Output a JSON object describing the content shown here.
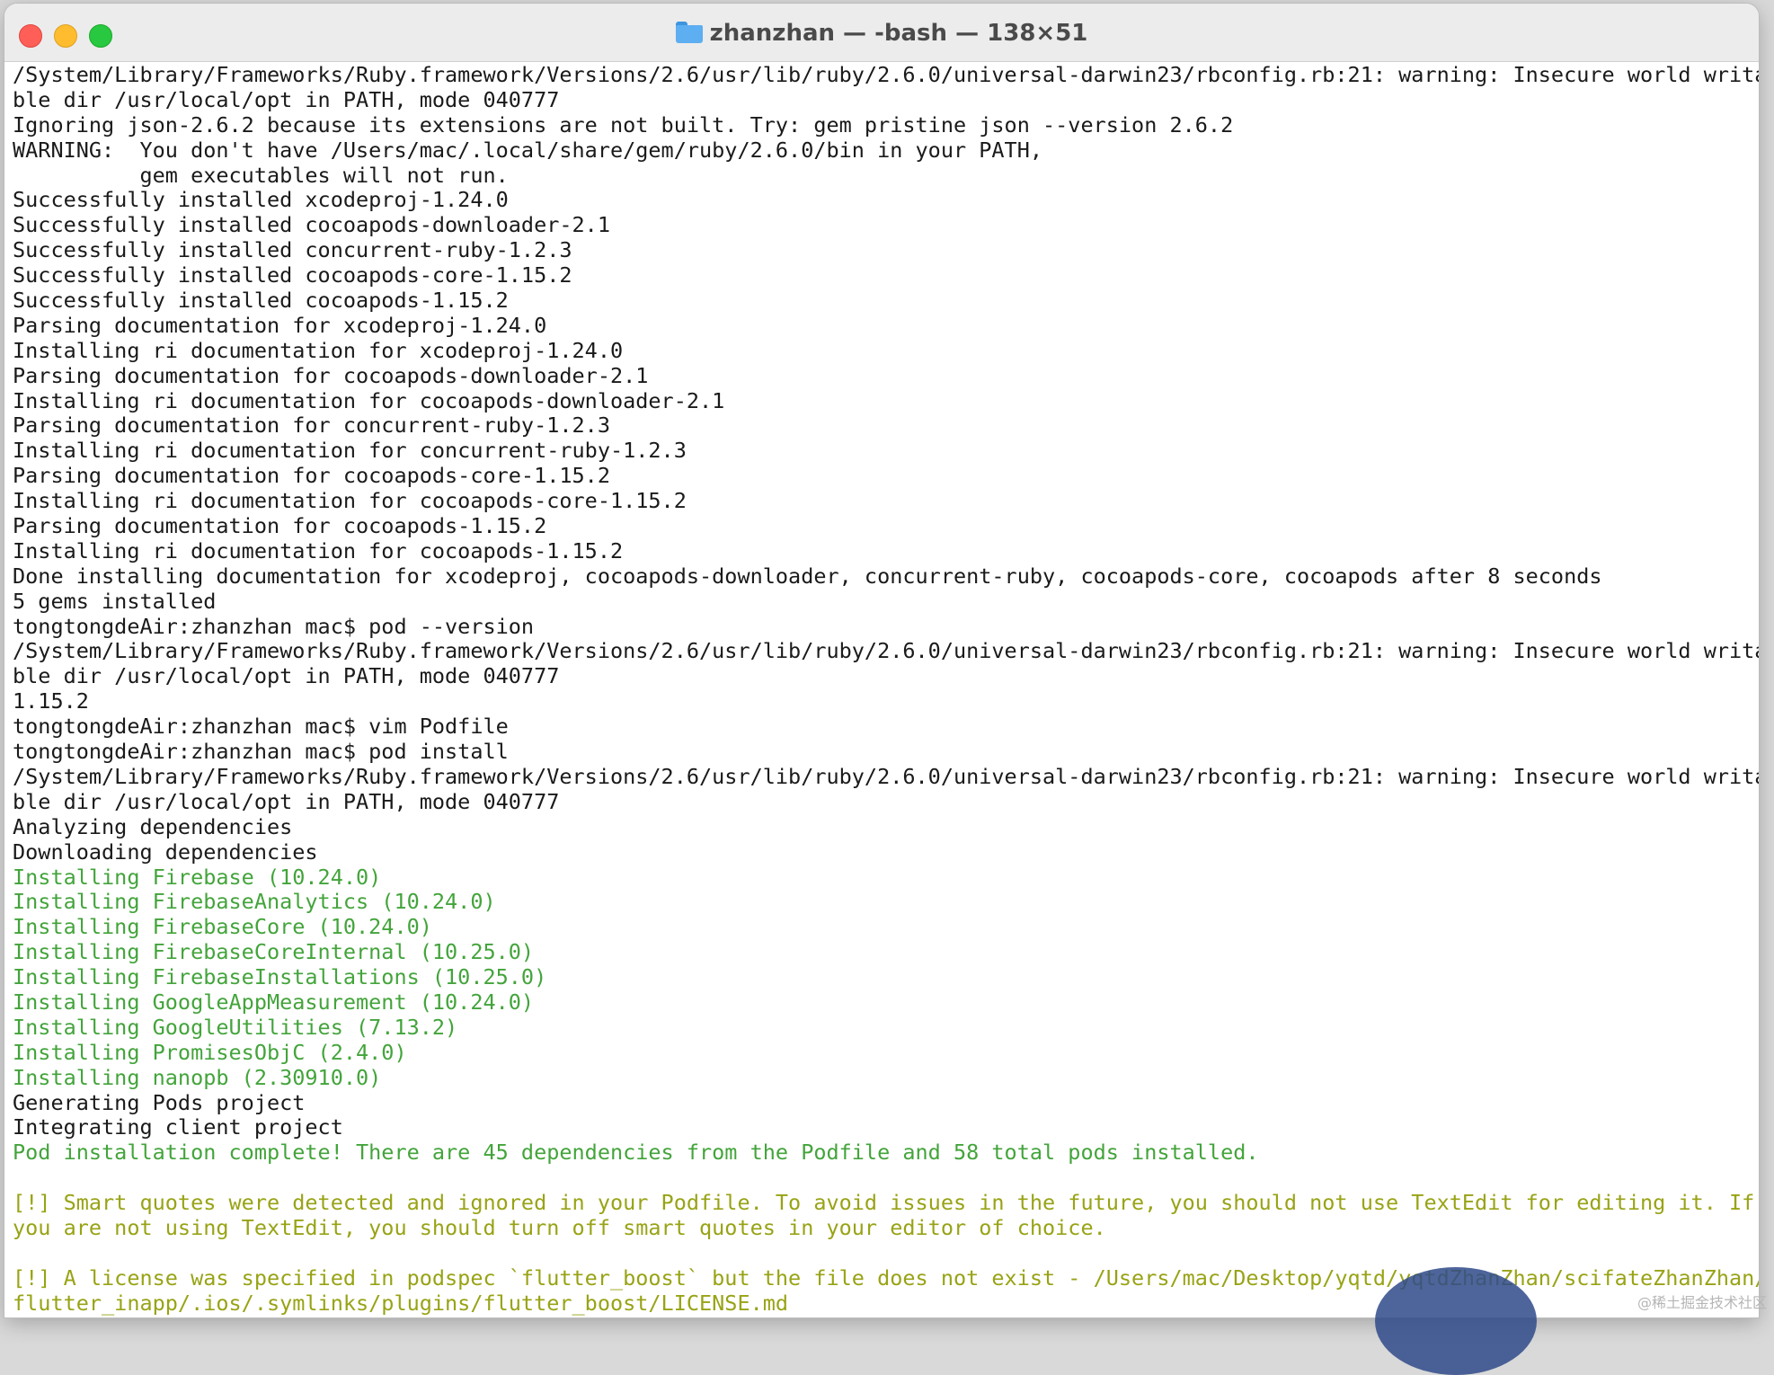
{
  "window": {
    "title": "zhanzhan — -bash — 138×51"
  },
  "colors": {
    "green": "#43a43b",
    "olive": "#98a315",
    "text": "#1a1a1a"
  },
  "terminal": {
    "lines": [
      {
        "text": "/System/Library/Frameworks/Ruby.framework/Versions/2.6/usr/lib/ruby/2.6.0/universal-darwin23/rbconfig.rb:21: warning: Insecure world writa",
        "color": "default"
      },
      {
        "text": "ble dir /usr/local/opt in PATH, mode 040777",
        "color": "default"
      },
      {
        "text": "Ignoring json-2.6.2 because its extensions are not built. Try: gem pristine json --version 2.6.2",
        "color": "default"
      },
      {
        "text": "WARNING:  You don't have /Users/mac/.local/share/gem/ruby/2.6.0/bin in your PATH,",
        "color": "default"
      },
      {
        "text": "          gem executables will not run.",
        "color": "default"
      },
      {
        "text": "Successfully installed xcodeproj-1.24.0",
        "color": "default"
      },
      {
        "text": "Successfully installed cocoapods-downloader-2.1",
        "color": "default"
      },
      {
        "text": "Successfully installed concurrent-ruby-1.2.3",
        "color": "default"
      },
      {
        "text": "Successfully installed cocoapods-core-1.15.2",
        "color": "default"
      },
      {
        "text": "Successfully installed cocoapods-1.15.2",
        "color": "default"
      },
      {
        "text": "Parsing documentation for xcodeproj-1.24.0",
        "color": "default"
      },
      {
        "text": "Installing ri documentation for xcodeproj-1.24.0",
        "color": "default"
      },
      {
        "text": "Parsing documentation for cocoapods-downloader-2.1",
        "color": "default"
      },
      {
        "text": "Installing ri documentation for cocoapods-downloader-2.1",
        "color": "default"
      },
      {
        "text": "Parsing documentation for concurrent-ruby-1.2.3",
        "color": "default"
      },
      {
        "text": "Installing ri documentation for concurrent-ruby-1.2.3",
        "color": "default"
      },
      {
        "text": "Parsing documentation for cocoapods-core-1.15.2",
        "color": "default"
      },
      {
        "text": "Installing ri documentation for cocoapods-core-1.15.2",
        "color": "default"
      },
      {
        "text": "Parsing documentation for cocoapods-1.15.2",
        "color": "default"
      },
      {
        "text": "Installing ri documentation for cocoapods-1.15.2",
        "color": "default"
      },
      {
        "text": "Done installing documentation for xcodeproj, cocoapods-downloader, concurrent-ruby, cocoapods-core, cocoapods after 8 seconds",
        "color": "default"
      },
      {
        "text": "5 gems installed",
        "color": "default"
      },
      {
        "text": "tongtongdeAir:zhanzhan mac$ pod --version",
        "color": "default"
      },
      {
        "text": "/System/Library/Frameworks/Ruby.framework/Versions/2.6/usr/lib/ruby/2.6.0/universal-darwin23/rbconfig.rb:21: warning: Insecure world writa",
        "color": "default"
      },
      {
        "text": "ble dir /usr/local/opt in PATH, mode 040777",
        "color": "default"
      },
      {
        "text": "1.15.2",
        "color": "default"
      },
      {
        "text": "tongtongdeAir:zhanzhan mac$ vim Podfile",
        "color": "default"
      },
      {
        "text": "tongtongdeAir:zhanzhan mac$ pod install",
        "color": "default"
      },
      {
        "text": "/System/Library/Frameworks/Ruby.framework/Versions/2.6/usr/lib/ruby/2.6.0/universal-darwin23/rbconfig.rb:21: warning: Insecure world writa",
        "color": "default"
      },
      {
        "text": "ble dir /usr/local/opt in PATH, mode 040777",
        "color": "default"
      },
      {
        "text": "Analyzing dependencies",
        "color": "default"
      },
      {
        "text": "Downloading dependencies",
        "color": "default"
      },
      {
        "text": "Installing Firebase (10.24.0)",
        "color": "green"
      },
      {
        "text": "Installing FirebaseAnalytics (10.24.0)",
        "color": "green"
      },
      {
        "text": "Installing FirebaseCore (10.24.0)",
        "color": "green"
      },
      {
        "text": "Installing FirebaseCoreInternal (10.25.0)",
        "color": "green"
      },
      {
        "text": "Installing FirebaseInstallations (10.25.0)",
        "color": "green"
      },
      {
        "text": "Installing GoogleAppMeasurement (10.24.0)",
        "color": "green"
      },
      {
        "text": "Installing GoogleUtilities (7.13.2)",
        "color": "green"
      },
      {
        "text": "Installing PromisesObjC (2.4.0)",
        "color": "green"
      },
      {
        "text": "Installing nanopb (2.30910.0)",
        "color": "green"
      },
      {
        "text": "Generating Pods project",
        "color": "default"
      },
      {
        "text": "Integrating client project",
        "color": "default"
      },
      {
        "text": "Pod installation complete! There are 45 dependencies from the Podfile and 58 total pods installed.",
        "color": "green"
      },
      {
        "text": "",
        "color": "default"
      },
      {
        "text": "[!] Smart quotes were detected and ignored in your Podfile. To avoid issues in the future, you should not use TextEdit for editing it. If",
        "color": "olive"
      },
      {
        "text": "you are not using TextEdit, you should turn off smart quotes in your editor of choice.",
        "color": "olive"
      },
      {
        "text": "",
        "color": "default"
      },
      {
        "text": "[!] A license was specified in podspec `flutter_boost` but the file does not exist - /Users/mac/Desktop/yqtd/yqtdZhanZhan/scifateZhanZhan/",
        "color": "olive"
      },
      {
        "text": "flutter_inapp/.ios/.symlinks/plugins/flutter_boost/LICENSE.md",
        "color": "olive"
      }
    ]
  },
  "watermark": "@稀土掘金技术社区"
}
